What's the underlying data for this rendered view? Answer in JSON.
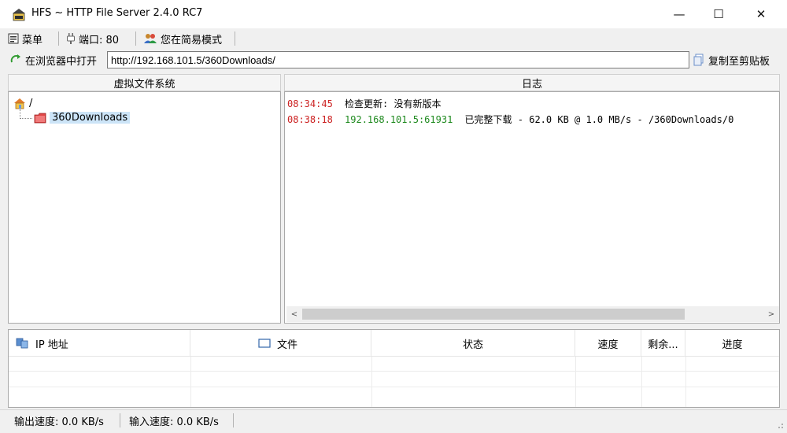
{
  "window": {
    "title": "HFS ~ HTTP File Server 2.4.0 RC7",
    "minimize_label": "—",
    "maximize_label": "☐",
    "close_label": "✕"
  },
  "toolbar": {
    "menu_label": "菜单",
    "port_label": "端口: 80",
    "mode_label": "您在简易模式"
  },
  "urlbar": {
    "open_label": "在浏览器中打开",
    "url_value": "http://192.168.101.5/360Downloads/",
    "copy_label": "复制至剪贴板"
  },
  "vfs": {
    "header": "虚拟文件系统",
    "root_label": "/",
    "child_label": "360Downloads"
  },
  "log": {
    "header": "日志",
    "entries": [
      {
        "time": "08:34:45",
        "ip": "",
        "message": "检查更新: 没有新版本"
      },
      {
        "time": "08:38:18",
        "ip": "192.168.101.5:61931",
        "message": "已完整下载 - 62.0 KB @ 1.0 MB/s - /360Downloads/0"
      }
    ],
    "scroll_left": "<",
    "scroll_right": ">"
  },
  "connections": {
    "columns": {
      "ip": "IP 地址",
      "file": "文件",
      "status": "状态",
      "speed": "速度",
      "remaining": "剩余...",
      "progress": "进度"
    }
  },
  "statusbar": {
    "out_speed": "输出速度: 0.0 KB/s",
    "in_speed": "输入速度: 0.0 KB/s"
  },
  "colors": {
    "log_time": "#cc2222",
    "log_ip": "#1f8a1f",
    "selection": "#cce4f7"
  }
}
